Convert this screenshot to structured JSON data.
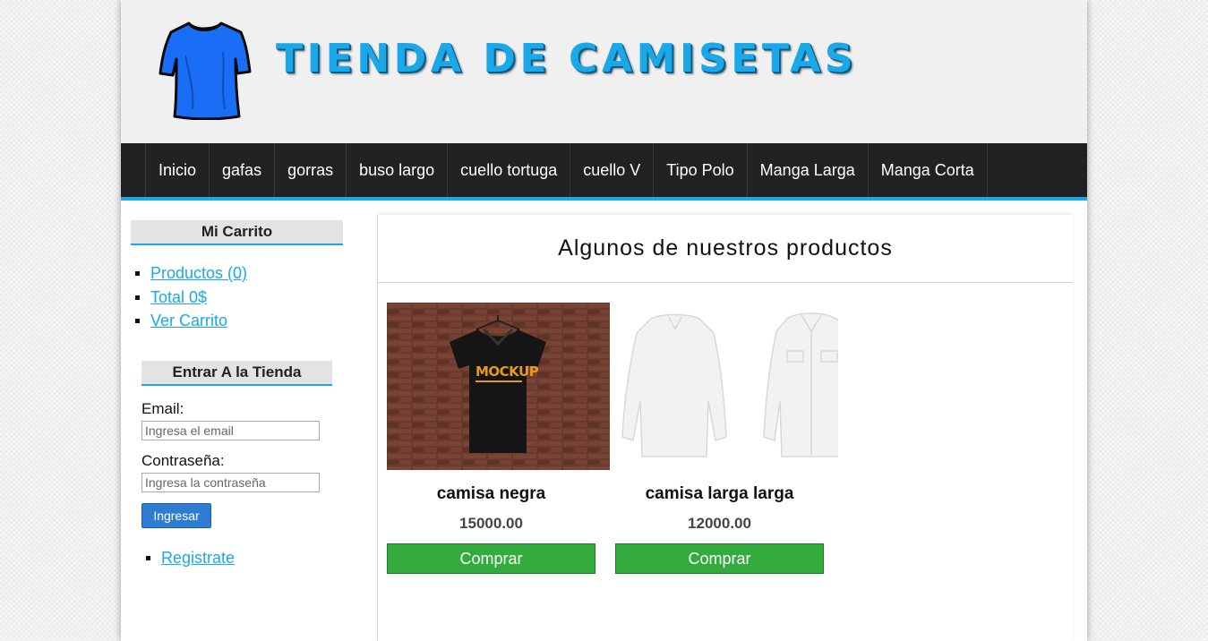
{
  "header": {
    "title": "TIENDA DE CAMISETAS",
    "logo_icon": "tshirt-icon",
    "accent_color": "#1ba8e8"
  },
  "nav": {
    "items": [
      {
        "label": "Inicio"
      },
      {
        "label": "gafas"
      },
      {
        "label": "gorras"
      },
      {
        "label": "buso largo"
      },
      {
        "label": "cuello tortuga"
      },
      {
        "label": "cuello V"
      },
      {
        "label": "Tipo Polo"
      },
      {
        "label": "Manga Larga"
      },
      {
        "label": "Manga Corta"
      }
    ]
  },
  "cart": {
    "title": "Mi Carrito",
    "products_link": "Productos (0)",
    "total_link": "Total 0$",
    "view_link": "Ver Carrito"
  },
  "login": {
    "title": "Entrar A la Tienda",
    "email_label": "Email:",
    "email_placeholder": "Ingresa el email",
    "password_label": "Contraseña:",
    "password_placeholder": "Ingresa la contraseña",
    "submit_label": "Ingresar",
    "register_link": "Registrate"
  },
  "main": {
    "title": "Algunos de nuestros productos",
    "products": [
      {
        "name": "camisa negra",
        "price": "15000.00",
        "buy_label": "Comprar",
        "image_print": "MOCKUP"
      },
      {
        "name": "camisa larga larga",
        "price": "12000.00",
        "buy_label": "Comprar"
      }
    ]
  }
}
